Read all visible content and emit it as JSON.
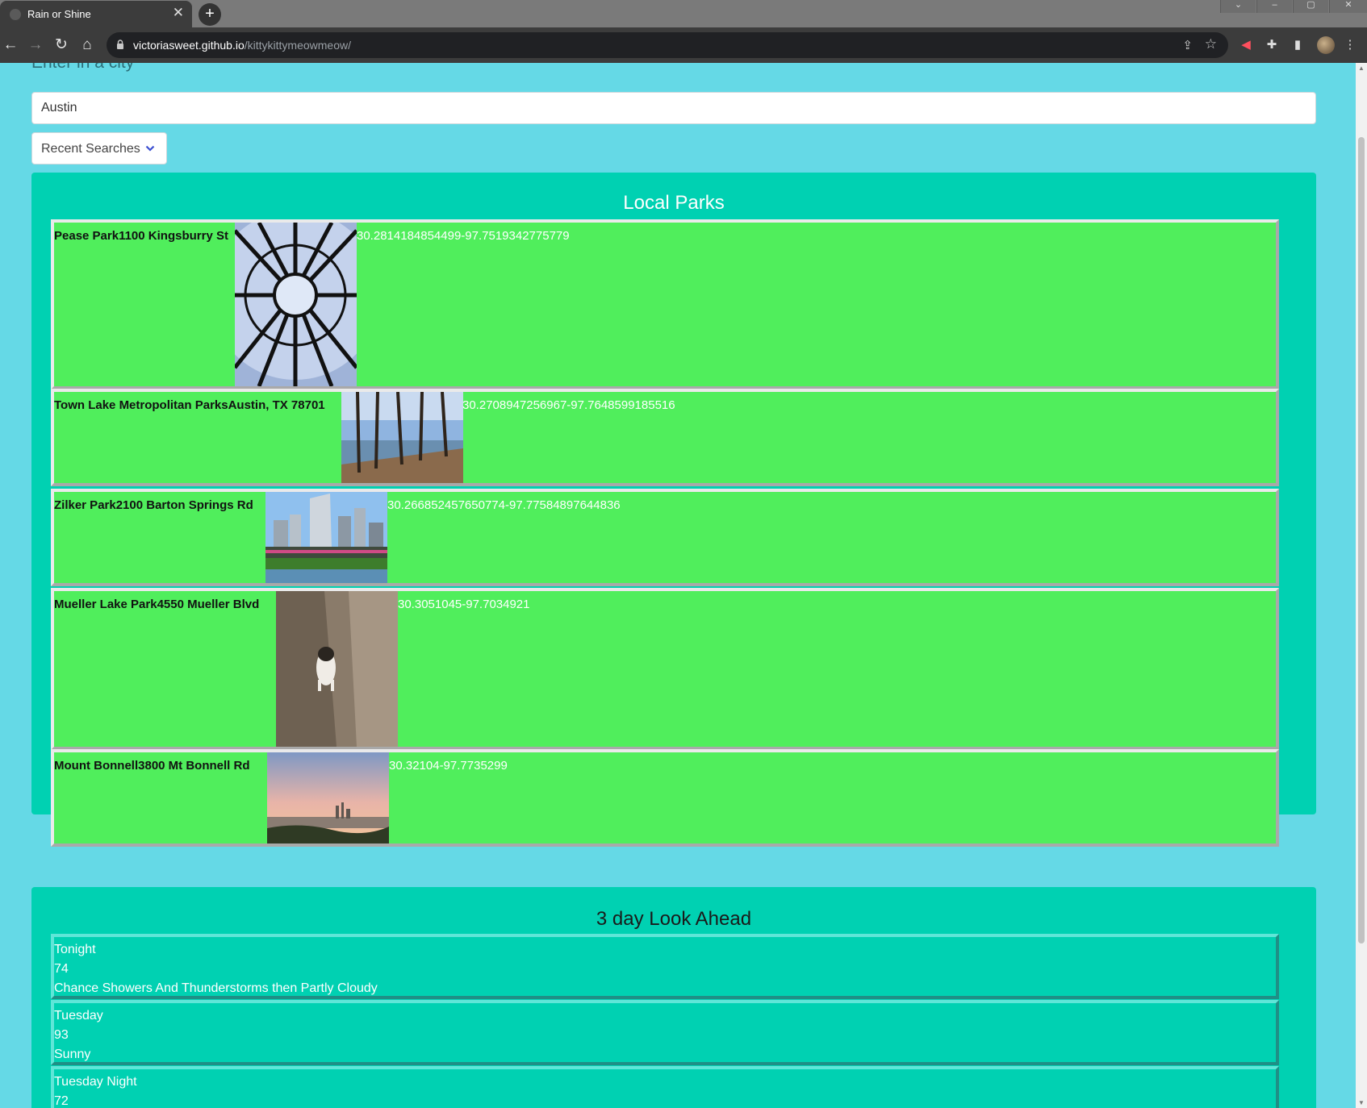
{
  "browser": {
    "tab_title": "Rain or Shine",
    "tab_close": "✕",
    "new_tab": "+",
    "url_host": "victoriasweet.github.io",
    "url_path": "/kittykittymeowmeow/"
  },
  "search": {
    "label": "Enter in a city",
    "value": "Austin",
    "recent_label": "Recent Searches"
  },
  "parks": {
    "title": "Local Parks",
    "items": [
      {
        "name": "Pease Park1100 Kingsburry St",
        "coords": "30.2814184854499-97.7519342775779",
        "photo": "glass-dome-photo"
      },
      {
        "name": "Town Lake Metropolitan ParksAustin, TX 78701",
        "coords": "30.2708947256967-97.7648599185516",
        "photo": "lakeside-trees-photo"
      },
      {
        "name": "Zilker Park2100 Barton Springs Rd",
        "coords": "30.266852457650774-97.77584897644836",
        "photo": "skyline-bridge-photo"
      },
      {
        "name": "Mueller Lake Park4550 Mueller Blvd",
        "coords": "30.3051045-97.7034921",
        "photo": "dog-tree-photo"
      },
      {
        "name": "Mount Bonnell3800 Mt Bonnell Rd",
        "coords": "30.32104-97.7735299",
        "photo": "sunset-city-photo"
      }
    ]
  },
  "forecast": {
    "title": "3 day Look Ahead",
    "days": [
      {
        "period": "Tonight",
        "temp": "74",
        "desc": "Chance Showers And Thunderstorms then Partly Cloudy"
      },
      {
        "period": "Tuesday",
        "temp": "93",
        "desc": "Sunny"
      },
      {
        "period": "Tuesday Night",
        "temp": "72",
        "desc": ""
      }
    ]
  },
  "colors": {
    "page_bg": "#65d9e6",
    "panel_bg": "#00d1b2",
    "park_card_bg": "#50ee5c"
  }
}
